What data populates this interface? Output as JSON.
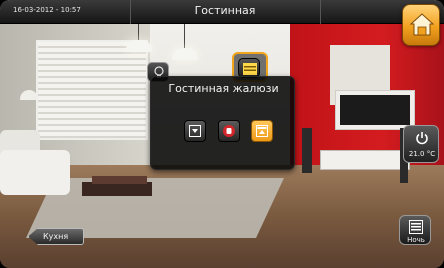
{
  "header": {
    "datetime": "16-03-2012 - 10:57",
    "title": "Гостинная"
  },
  "popup": {
    "title": "Гостинная жалюзи",
    "controls": [
      {
        "icon": "blinds-down-icon",
        "active": false
      },
      {
        "icon": "stop-hand-icon",
        "active": false
      },
      {
        "icon": "blinds-up-icon",
        "active": true
      }
    ]
  },
  "thermostat": {
    "temperature": "21.0 °C"
  },
  "night_mode": {
    "label": "Ночь"
  },
  "back_button": {
    "label": "Кухня"
  },
  "colors": {
    "accent": "#f2a11f",
    "header": "#1e1e1e"
  }
}
